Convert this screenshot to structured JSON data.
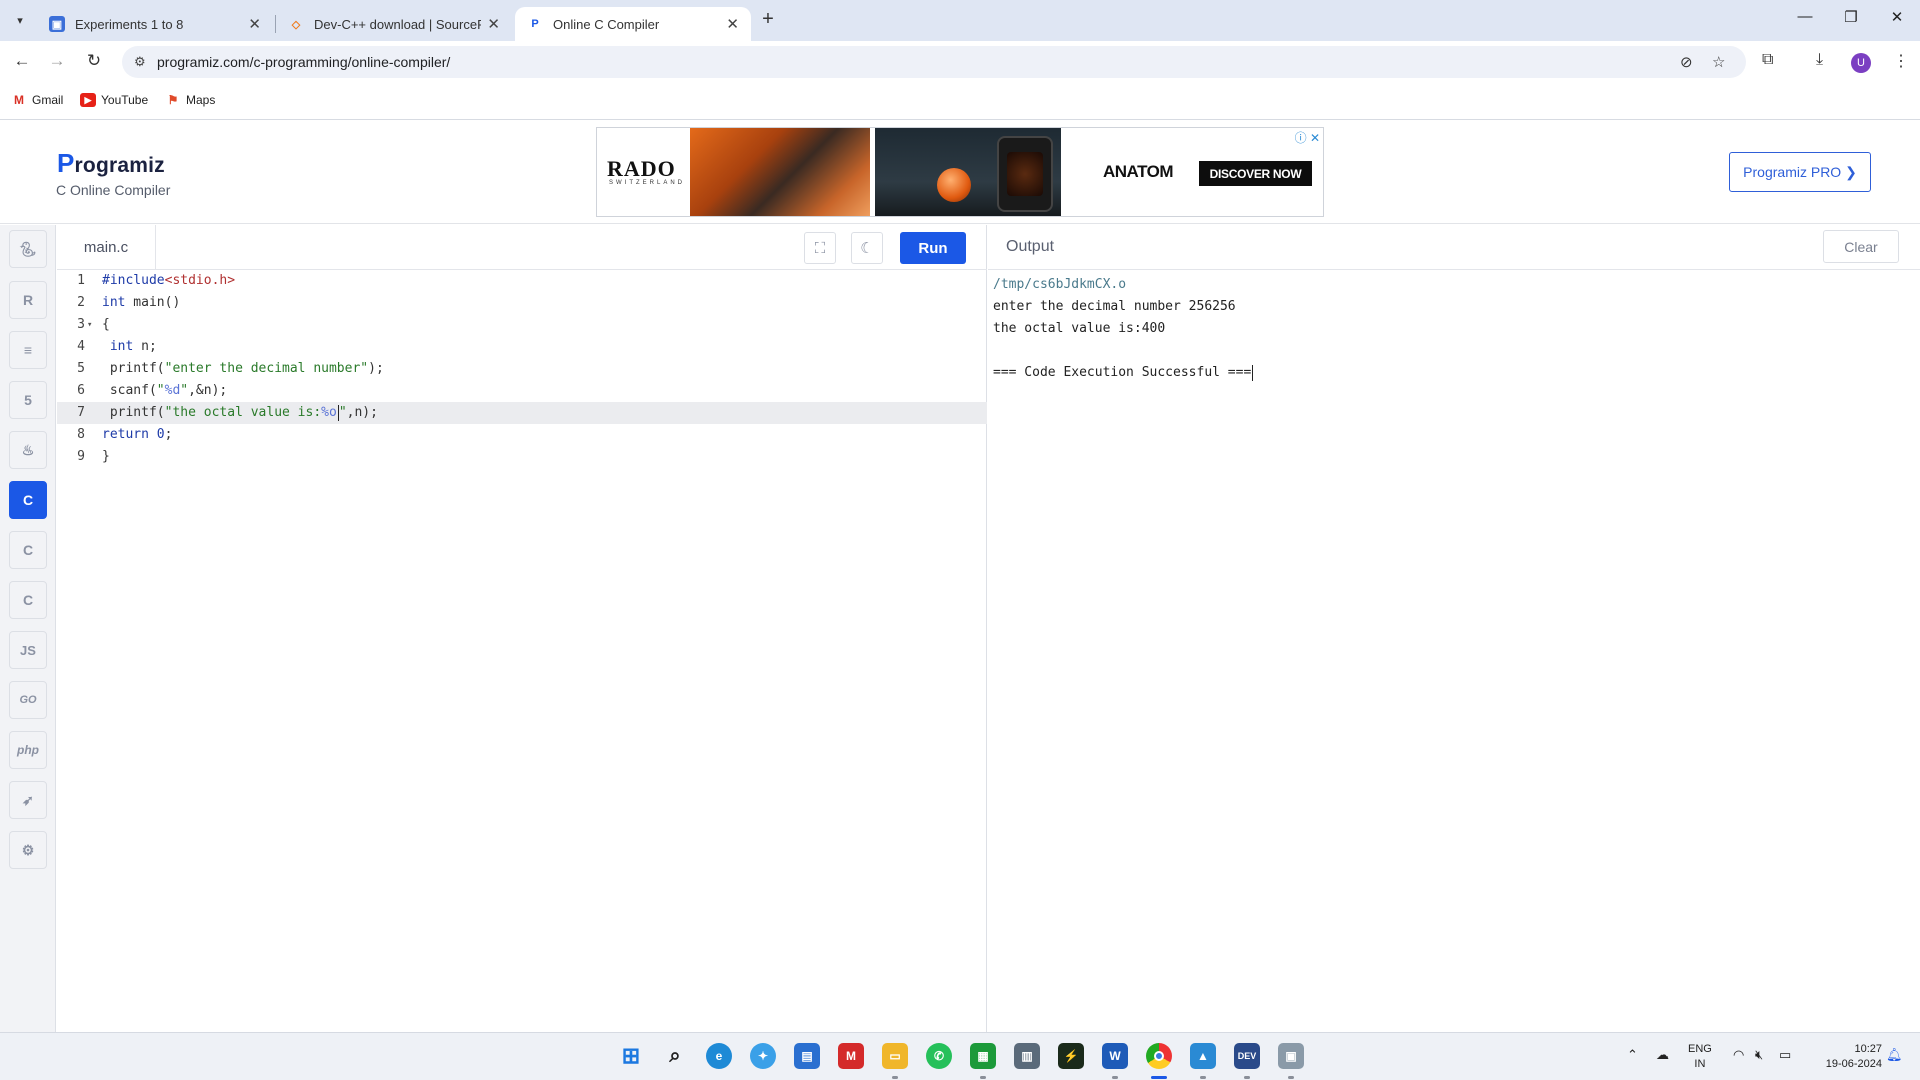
{
  "browser": {
    "tabs": [
      {
        "title": "Experiments 1 to 8",
        "active": false
      },
      {
        "title": "Dev-C++ download | SourceForge",
        "active": false
      },
      {
        "title": "Online C Compiler",
        "active": true
      }
    ],
    "url": "programiz.com/c-programming/online-compiler/",
    "avatar_letter": "U",
    "bookmarks": [
      "Gmail",
      "YouTube",
      "Maps"
    ]
  },
  "site": {
    "logo": "rogramiz",
    "logo_letter": "P",
    "subtitle": "C Online Compiler",
    "pro_button": "Programiz PRO ❯"
  },
  "ad": {
    "brand": "RADO",
    "brand_sub": "SWITZERLAND",
    "model": "ANATOM",
    "cta": "DISCOVER NOW"
  },
  "editor": {
    "file_name": "main.c",
    "run_label": "Run",
    "code_lines": [
      "#include<stdio.h>",
      "int main()",
      "{",
      " int n;",
      " printf(\"enter the decimal number\");",
      " scanf(\"%d\",&n);",
      " printf(\"the octal value is:%o\",n);",
      "return 0;",
      "}"
    ],
    "line_numbers": [
      "1",
      "2",
      "3",
      "4",
      "5",
      "6",
      "7",
      "8",
      "9"
    ],
    "highlighted_line": 7
  },
  "output": {
    "title": "Output",
    "clear_label": "Clear",
    "lines": [
      "/tmp/cs6bJdkmCX.o",
      "enter the decimal number 256256",
      "the octal value is:400",
      "",
      "=== Code Execution Successful ==="
    ]
  },
  "sidebar": {
    "languages": [
      "python-icon",
      "r-icon",
      "sql-icon",
      "html-icon",
      "java-icon",
      "c-icon",
      "cpp-icon",
      "csharp-icon",
      "js-icon",
      "go-icon",
      "php-icon",
      "swift-icon",
      "rust-icon"
    ],
    "labels": {
      "js": "JS",
      "go": "GO",
      "php": "php"
    },
    "active": "c-icon"
  },
  "taskbar": {
    "lang_top": "ENG",
    "lang_bottom": "IN",
    "time": "10:27",
    "date": "19-06-2024"
  },
  "colors": {
    "accent": "#1b58e6",
    "run_button": "#1b58e6"
  }
}
